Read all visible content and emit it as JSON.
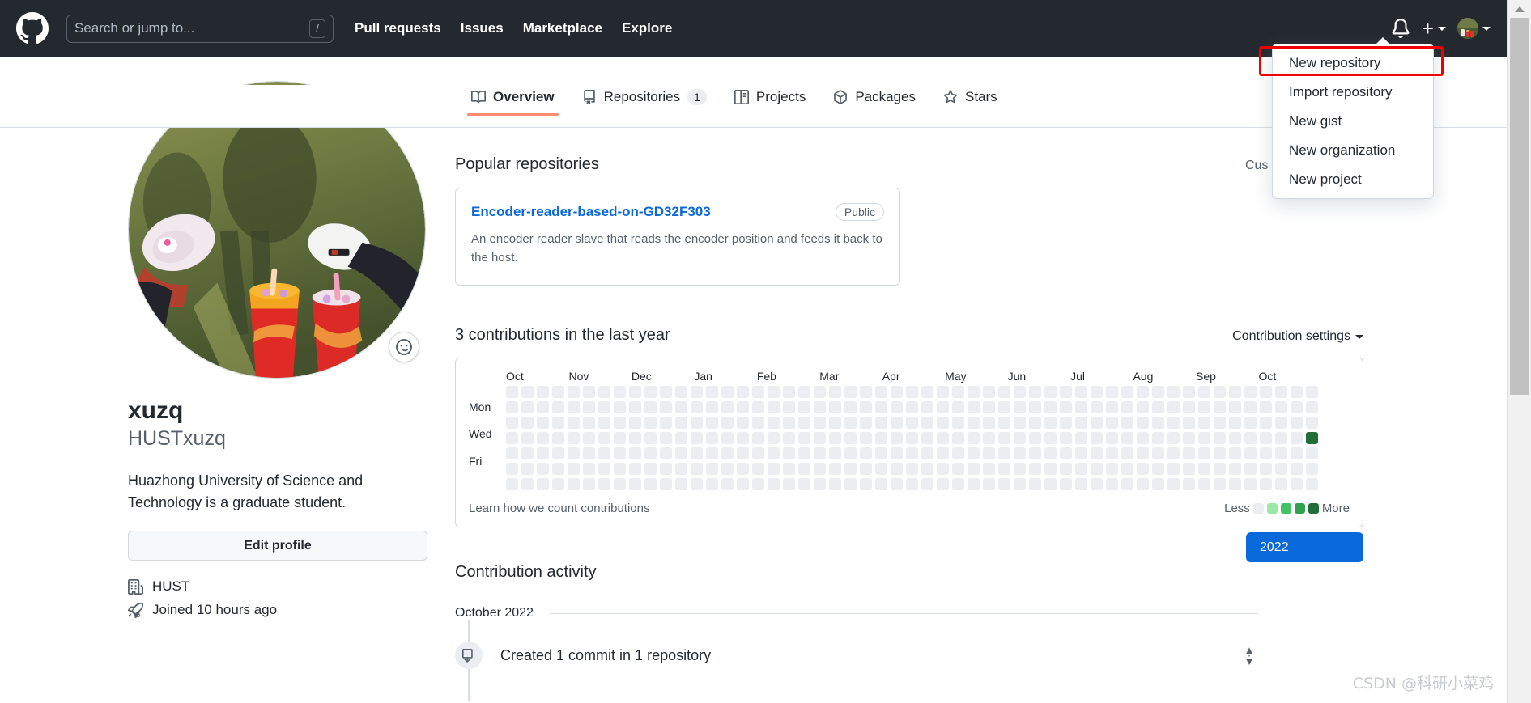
{
  "header": {
    "logo_icon": "github-mark-icon",
    "search": {
      "placeholder": "Search or jump to...",
      "shortcut_key": "/"
    },
    "nav": [
      {
        "label": "Pull requests"
      },
      {
        "label": "Issues"
      },
      {
        "label": "Marketplace"
      },
      {
        "label": "Explore"
      }
    ],
    "notifications_icon": "bell-icon",
    "create_new_icon": "plus-icon",
    "avatar_icon": "user-avatar-icon"
  },
  "create_menu": {
    "items": [
      {
        "label": "New repository",
        "highlighted": true
      },
      {
        "label": "Import repository",
        "highlighted": false
      },
      {
        "label": "New gist",
        "highlighted": false
      },
      {
        "label": "New organization",
        "highlighted": false
      },
      {
        "label": "New project",
        "highlighted": false
      }
    ],
    "highlight_color": "#ee0000"
  },
  "tabs": [
    {
      "label": "Overview",
      "icon": "book-icon",
      "count": "",
      "active": true
    },
    {
      "label": "Repositories",
      "icon": "repo-icon",
      "count": "1",
      "active": false
    },
    {
      "label": "Projects",
      "icon": "project-icon",
      "count": "",
      "active": false
    },
    {
      "label": "Packages",
      "icon": "package-icon",
      "count": "",
      "active": false
    },
    {
      "label": "Stars",
      "icon": "star-icon",
      "count": "",
      "active": false
    }
  ],
  "profile": {
    "avatar_icon": "profile-photo",
    "emoji_button_icon": "smiley-icon",
    "name": "xuzq",
    "handle": "HUSTxuzq",
    "bio": "Huazhong University of Science and Technology is a graduate student.",
    "edit_button": "Edit profile",
    "meta": [
      {
        "icon": "organization-icon",
        "text": "HUST"
      },
      {
        "icon": "rocket-icon",
        "text": "Joined 10 hours ago"
      }
    ]
  },
  "popular": {
    "title": "Popular repositories",
    "repos": [
      {
        "name": "Encoder-reader-based-on-GD32F303",
        "visibility": "Public",
        "description": "An encoder reader slave that reads the encoder position and feeds it back to the host."
      }
    ]
  },
  "customize_pins_partial": "Cus",
  "contributions": {
    "title": "3 contributions in the last year",
    "settings_label": "Contribution settings",
    "learn_link": "Learn how we count contributions",
    "legend_less": "Less",
    "legend_more": "More"
  },
  "activity": {
    "title": "Contribution activity",
    "year_button": "2022",
    "month_label": "October 2022",
    "items": [
      {
        "icon": "commit-icon",
        "text": "Created 1 commit in 1 repository"
      }
    ]
  },
  "watermark": "CSDN @科研小菜鸡",
  "colors": {
    "header_bg": "#24292f",
    "link": "#0969da",
    "accent_tab": "#fd8c73",
    "contrib_l0": "#ebedf0",
    "contrib_l1": "#9be9a8",
    "contrib_l2": "#40c463",
    "contrib_l3": "#30a14e",
    "contrib_l4": "#216e39"
  },
  "chart_data": {
    "type": "heatmap",
    "title": "3 contributions in the last year",
    "months": [
      "Oct",
      "Nov",
      "Dec",
      "Jan",
      "Feb",
      "Mar",
      "Apr",
      "May",
      "Jun",
      "Jul",
      "Aug",
      "Sep",
      "Oct"
    ],
    "day_labels": [
      "",
      "Mon",
      "",
      "Wed",
      "",
      "Fri",
      ""
    ],
    "weeks": 53,
    "days_per_week": 7,
    "levels": [
      0,
      1,
      2,
      3,
      4
    ],
    "level_colors": [
      "#ebedf0",
      "#9be9a8",
      "#40c463",
      "#30a14e",
      "#216e39"
    ],
    "total_contributions": 3,
    "filled_cells": [
      {
        "week": 52,
        "day": 3,
        "level": 4
      }
    ],
    "legend": {
      "less": "Less",
      "more": "More",
      "position": "bottom-right"
    }
  }
}
